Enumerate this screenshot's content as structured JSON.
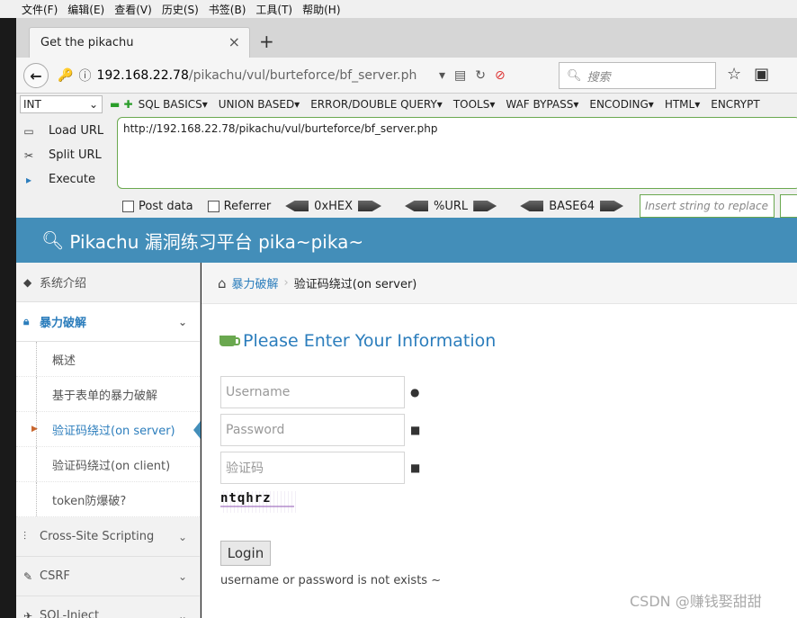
{
  "menubar": [
    "文件(F)",
    "编辑(E)",
    "查看(V)",
    "历史(S)",
    "书签(B)",
    "工具(T)",
    "帮助(H)"
  ],
  "tab": {
    "title": "Get the pikachu",
    "close": "×",
    "new": "+"
  },
  "nav": {
    "url_host": "192.168.22.78",
    "url_path": "/pikachu/vul/burteforce/bf_server.ph",
    "search_placeholder": "搜索"
  },
  "hackbar": {
    "select": "INT",
    "menu": [
      "SQL BASICS▾",
      "UNION BASED▾",
      "ERROR/DOUBLE QUERY▾",
      "TOOLS▾",
      "WAF BYPASS▾",
      "ENCODING▾",
      "HTML▾",
      "ENCRYPT"
    ],
    "load_url": "Load URL",
    "split_url": "Split URL",
    "execute": "Execute",
    "url_value": "http://192.168.22.78/pikachu/vul/burteforce/bf_server.php",
    "post_data": "Post data",
    "referrer": "Referrer",
    "hex": "0xHEX",
    "urlenc": "%URL",
    "base64": "BASE64",
    "replace_placeholder": "Insert string to replace"
  },
  "header": {
    "title": "Pikachu 漏洞练习平台 pika~pika~"
  },
  "sidebar": {
    "intro": "系统介绍",
    "brute": "暴力破解",
    "subs": [
      "概述",
      "基于表单的暴力破解",
      "验证码绕过(on server)",
      "验证码绕过(on client)",
      "token防爆破?"
    ],
    "xss": "Cross-Site Scripting",
    "csrf": "CSRF",
    "sqli": "SQL-Inject"
  },
  "breadcrumb": {
    "link": "暴力破解",
    "sep": "›",
    "current": "验证码绕过(on server)"
  },
  "form": {
    "title": "Please Enter Your Information",
    "username_placeholder": "Username",
    "password_placeholder": "Password",
    "captcha_placeholder": "验证码",
    "captcha_text": "ntqhrz",
    "login": "Login",
    "message": "username or password is not exists ~"
  },
  "watermark": "CSDN @赚钱娶甜甜"
}
